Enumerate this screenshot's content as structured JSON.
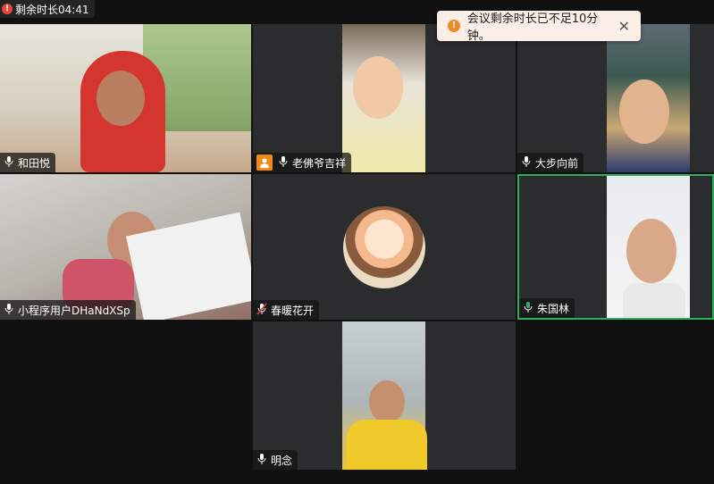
{
  "timer": {
    "label": "剩余时长04:41"
  },
  "toast": {
    "message": "会议剩余时长已不足10分钟。",
    "close": "✕"
  },
  "participants": [
    {
      "name": "和田悦",
      "mic": "on",
      "host": false,
      "active": false
    },
    {
      "name": "老佛爷吉祥",
      "mic": "on",
      "host": true,
      "active": false
    },
    {
      "name": "大步向前",
      "mic": "on",
      "host": false,
      "active": false
    },
    {
      "name": "小程序用户DHaNdXSp",
      "mic": "on",
      "host": false,
      "active": false
    },
    {
      "name": "春暖花开",
      "mic": "muted",
      "host": false,
      "active": false
    },
    {
      "name": "朱国林",
      "mic": "on",
      "host": false,
      "active": true
    },
    {
      "name": "明念",
      "mic": "on",
      "host": false,
      "active": false
    }
  ],
  "colors": {
    "active_border": "#2fae62",
    "host_badge": "#f28a1a",
    "muted": "#e5483a"
  }
}
